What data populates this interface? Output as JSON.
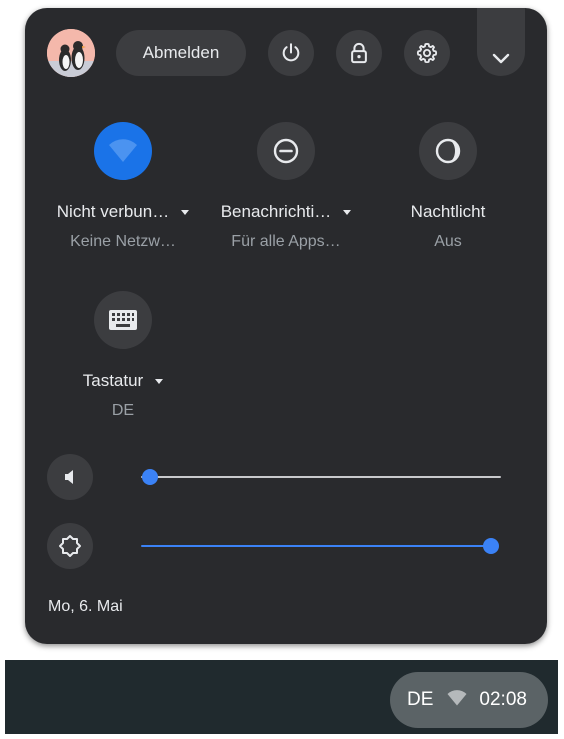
{
  "top_row": {
    "avatar": "user-avatar",
    "sign_out_label": "Abmelden",
    "power_icon": "power-icon",
    "lock_icon": "lock-icon",
    "settings_icon": "gear-icon",
    "expand_icon": "chevron-down-icon"
  },
  "tiles": [
    {
      "label": "Nicht verbun…",
      "sub": "Keine Netzw…",
      "icon": "wifi-icon",
      "active": true,
      "has_menu": true
    },
    {
      "label": "Benachrichti…",
      "sub": "Für alle Apps…",
      "icon": "do-not-disturb-icon",
      "active": false,
      "has_menu": true
    },
    {
      "label": "Nachtlicht",
      "sub": "Aus",
      "icon": "night-light-icon",
      "active": false,
      "has_menu": false
    },
    {
      "label": "Tastatur",
      "sub": "DE",
      "icon": "keyboard-icon",
      "active": false,
      "has_menu": true
    }
  ],
  "sliders": {
    "volume": {
      "icon": "volume-icon",
      "level": 0.0
    },
    "brightness": {
      "icon": "brightness-icon",
      "level": 1.0
    }
  },
  "date": "Mo, 6. Mai",
  "shelf": {
    "ime": "DE",
    "wifi_icon": "wifi-icon",
    "time": "02:08"
  },
  "colors": {
    "panel_bg": "#292a2d",
    "button_bg": "#3c3d40",
    "accent": "#1a73e8",
    "slider_blue": "#3b82f6",
    "shelf_bg": "#202a2e",
    "status_pill": "#5b6366"
  }
}
